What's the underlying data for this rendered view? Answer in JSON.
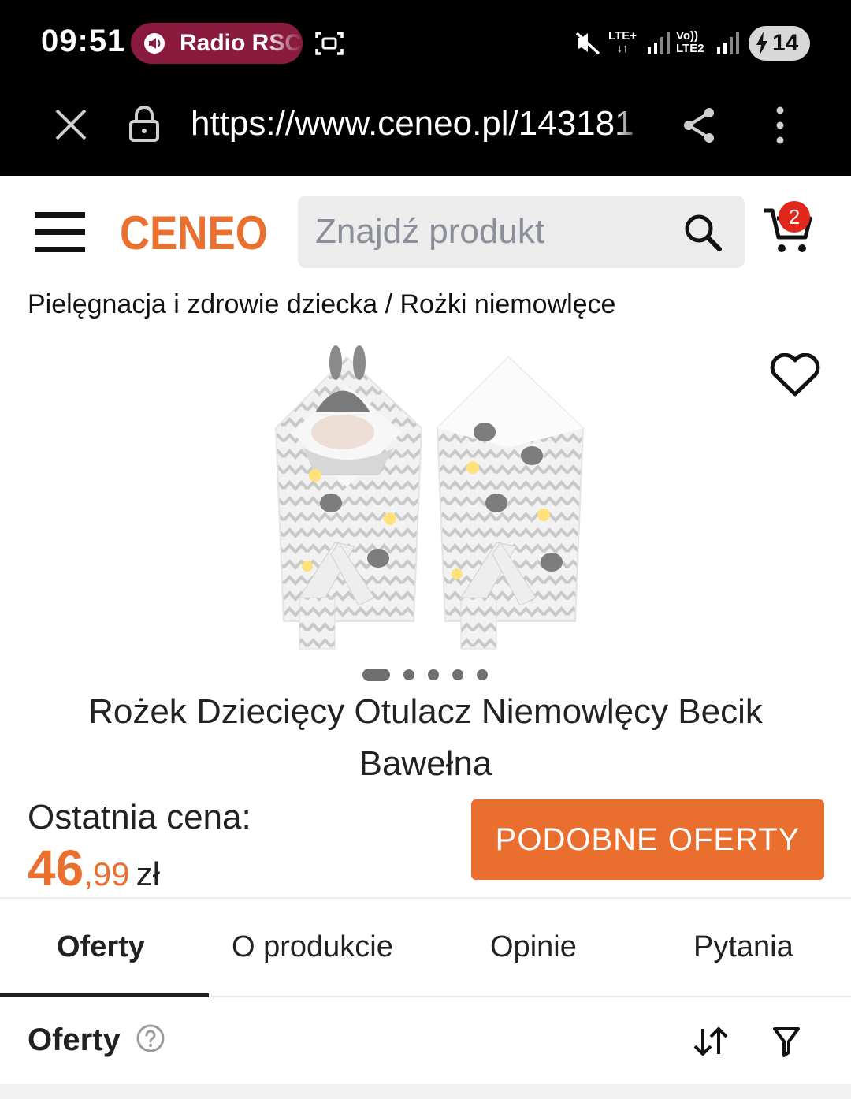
{
  "status_bar": {
    "time": "09:51",
    "media_pill": "Radio RSC",
    "network1": [
      "LTE+",
      "↓↑"
    ],
    "network2": [
      "Vo))",
      "LTE2"
    ],
    "battery": "14"
  },
  "browser": {
    "url": "https://www.ceneo.pl/143181"
  },
  "header": {
    "logo": "CENEO",
    "search_placeholder": "Znajdź produkt",
    "cart_count": "2"
  },
  "breadcrumb": {
    "parent": "Pielęgnacja i zdrowie dziecka",
    "separator": " / ",
    "current": "Rożki niemowlęce"
  },
  "product": {
    "title": "Rożek Dziecięcy Otulacz Niemowlęcy Becik Bawełna",
    "image_count": 5,
    "active_image": 1,
    "last_price_label": "Ostatnia cena:",
    "price_whole": "46",
    "price_fraction": ",99",
    "price_currency": "zł",
    "similar_button": "PODOBNE OFERTY"
  },
  "tabs": [
    {
      "label": "Oferty",
      "active": true
    },
    {
      "label": "O produkcie",
      "active": false
    },
    {
      "label": "Opinie",
      "active": false
    },
    {
      "label": "Pytania",
      "active": false
    }
  ],
  "offers": {
    "title": "Oferty"
  },
  "icons": {
    "media": "speaker-icon",
    "screenshot": "screen-record-icon",
    "mute": "mute-icon",
    "close": "close-icon",
    "lock": "lock-icon",
    "share": "share-icon",
    "more": "more-vertical-icon",
    "menu": "hamburger-icon",
    "search": "search-icon",
    "cart": "cart-icon",
    "favorite": "heart-icon",
    "help": "help-icon",
    "sort": "sort-icon",
    "filter": "filter-icon"
  },
  "colors": {
    "brand": "#e9702e",
    "button": "#ea6e2e",
    "badge": "#e1261c",
    "media_pill": "#8a1a3e"
  }
}
